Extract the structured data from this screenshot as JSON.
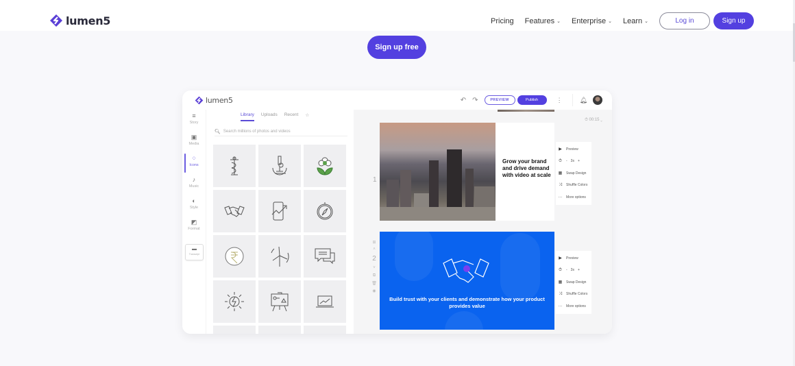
{
  "brand": {
    "name": "lumen5",
    "accent": "#5340e0"
  },
  "nav": {
    "links": [
      {
        "label": "Pricing",
        "dropdown": false
      },
      {
        "label": "Features",
        "dropdown": true
      },
      {
        "label": "Enterprise",
        "dropdown": true
      },
      {
        "label": "Learn",
        "dropdown": true
      }
    ],
    "login_label": "Log in",
    "signup_label": "Sign up"
  },
  "hero": {
    "cta_label": "Sign up free"
  },
  "editor": {
    "logo": "lumen5",
    "toolbar": {
      "undo_icon": "undo-icon",
      "redo_icon": "redo-icon",
      "preview_label": "PREVIEW",
      "publish_label": "Publish"
    },
    "sidebar": [
      {
        "label": "Story",
        "icon": "story-icon",
        "glyph": "≡",
        "active": false
      },
      {
        "label": "Media",
        "icon": "media-icon",
        "glyph": "▣",
        "active": false
      },
      {
        "label": "Icons",
        "icon": "icons-icon",
        "glyph": "⁘",
        "active": true
      },
      {
        "label": "Music",
        "icon": "music-icon",
        "glyph": "♪",
        "active": false
      },
      {
        "label": "Style",
        "icon": "style-icon",
        "glyph": "◐",
        "active": false
      },
      {
        "label": "Format",
        "icon": "format-icon",
        "glyph": "◩",
        "active": false
      }
    ],
    "transcript_label": "Transcript",
    "library": {
      "tabs": [
        {
          "label": "Library",
          "active": true
        },
        {
          "label": "Uploads",
          "active": false
        },
        {
          "label": "Recent",
          "active": false
        },
        {
          "label": "☆",
          "active": false
        }
      ],
      "search_placeholder": "Search millions of photos and videos",
      "icons": [
        "caduceus",
        "microscope",
        "flower",
        "handshake",
        "phone-chart",
        "compass",
        "rupee-coin",
        "wind-turbine",
        "chat-bubbles",
        "solar-energy",
        "presentation-board",
        "laptop-chart"
      ]
    },
    "duration": "⏱ 00:15 ⌄",
    "slides": [
      {
        "number": "1",
        "text": "Grow your brand and drive demand with video at scale",
        "menu": {
          "preview": "Preview",
          "duration": "3s",
          "swap": "Swap Design",
          "shuffle": "Shuffle Colors",
          "more": "More options"
        }
      },
      {
        "number": "2",
        "text": "Build trust with your clients and demonstrate how your product provides value",
        "menu": {
          "preview": "Preview",
          "duration": "3s",
          "swap": "Swap Design",
          "shuffle": "Shuffle Colors",
          "more": "More options"
        }
      }
    ]
  }
}
